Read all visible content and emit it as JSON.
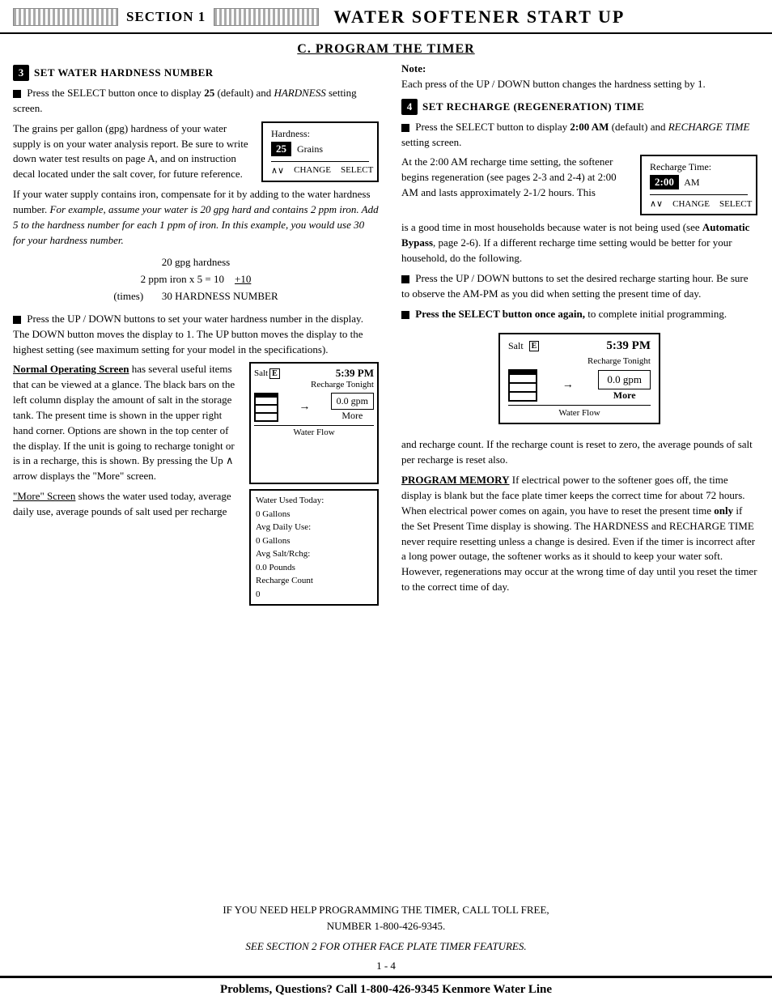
{
  "header": {
    "section_label": "SECTION 1",
    "title": "WATER SOFTENER START UP"
  },
  "subtitle": "C.  PROGRAM THE TIMER",
  "section3": {
    "num": "3",
    "title": "SET WATER HARDNESS NUMBER",
    "para1": "Press the SELECT button once to display 25 (default) and HARDNESS setting screen.",
    "para1_plain": "Press the SELECT button once to display ",
    "para1_val": "25",
    "para1_end": " (default) and ",
    "para1_italic": "HARDNESS",
    "para1_final": " setting screen.",
    "hardness_text": "The grains per gallon (gpg) hardness of your water supply is on your water analysis report. Be sure to write down water test results on page A, and on instruction decal located under the salt cover, for future reference.",
    "hardness_box_title": "Hardness:",
    "hardness_value": "25",
    "hardness_unit": "Grains",
    "btn_change": "CHANGE",
    "btn_select": "SELECT",
    "btn_av": "∧∨",
    "iron_para": "If your water supply contains iron, compensate for it by adding to the water hardness number.",
    "iron_italic": "For example, assume your water is 20 gpg hard and contains 2 ppm iron. Add 5 to the hardness number for each 1 ppm of iron. In this example, you would use 30 for your hardness number.",
    "math_gpg": "20 gpg hardness",
    "math_iron": "2 ppm iron x 5 = 10",
    "math_plus10": "+10",
    "math_times": "(times)",
    "math_result": "30 HARDNESS NUMBER",
    "set_para": "Press the UP / DOWN buttons to set your water hardness number in the display. The DOWN button moves the display to 1. The UP button moves the display to the highest setting (see maximum setting for your model in the specifications).",
    "nos_heading": "Normal Operating Screen",
    "nos_text1": "has several useful items that can be viewed at a glance. The black bars on the left column display the amount of salt in the storage tank. The present time is shown in the upper right hand corner. Options are shown in the top center of the display. If the unit is going to recharge tonight or is in a recharge, this is shown. By pressing the Up ∧ arrow displays the \"More\" screen.",
    "nos_salt": "Salt",
    "nos_e": "E",
    "nos_time": "5:39 PM",
    "nos_recharge": "Recharge Tonight",
    "nos_gpm": "0.0 gpm",
    "nos_arrow": "→",
    "nos_more": "More",
    "nos_waterflow": "Water Flow",
    "more_heading": "\"More\" Screen",
    "more_text": "shows the water used today, average daily use, average pounds of salt used per recharge",
    "more_screen_line1": "Water Used Today:",
    "more_screen_line2": "0 Gallons",
    "more_screen_line3": "Avg Daily Use:",
    "more_screen_line4": "0 Gallons",
    "more_screen_line5": "Avg Salt/Rchg:",
    "more_screen_line6": "0.0 Pounds",
    "more_screen_line7": "Recharge Count",
    "more_screen_line8": "0"
  },
  "section4": {
    "num": "4",
    "title": "SET RECHARGE (REGENERATION) TIME",
    "note_label": "Note:",
    "note_text": "Each press of the UP / DOWN button changes the hardness setting by 1.",
    "para1_plain": "Press the SELECT button to display ",
    "para1_val": "2:00 AM",
    "para1_italic": "RECHARGE TIME",
    "para1_end": " (default) and ",
    "para1_final": " setting screen.",
    "recharge_box_title": "Recharge Time:",
    "recharge_value": "2:00",
    "recharge_unit": "AM",
    "btn_av": "∧∨",
    "btn_change": "CHANGE",
    "btn_select": "SELECT",
    "recharge_desc": "At the 2:00 AM recharge time setting, the softener begins regeneration (see pages 2-3 and 2-4) at 2:00 AM and lasts approximately 2-1/2 hours. This is a good time in most households because water is not being used (see Automatic Bypass, page 2-6). If a different recharge time setting would be better for your household, do the following.",
    "set_recharge": "Press the UP / DOWN buttons to set the desired recharge starting hour. Be sure to observe the AM-PM as you did when setting the present time of day.",
    "press_select": "Press the SELECT button once again,",
    "press_select_end": " to complete initial programming.",
    "big_salt": "Salt",
    "big_e": "E",
    "big_time": "5:39 PM",
    "big_recharge": "Recharge Tonight",
    "big_gpm": "0.0 gpm",
    "big_arrow": "→",
    "big_more": "More",
    "big_waterflow": "Water Flow",
    "recharge_count_text": "and recharge count.  If the recharge count is reset to zero, the average pounds of salt per recharge is reset also.",
    "program_mem_heading": "PROGRAM MEMORY",
    "program_mem_text": " If electrical power to the softener goes off, the time display is blank but the face plate timer keeps the correct time for about 72 hours. When electrical power comes on again, you have to reset the present time ",
    "program_mem_bold": "only",
    "program_mem_text2": " if the Set Present Time display is showing.  The HARDNESS and RECHARGE TIME never require resetting unless a change is desired.  Even if the timer is incorrect after a long power outage, the softener works as it should to keep your water soft.  However, regenerations may occur at the wrong time of day until you reset the timer to the correct time of day."
  },
  "footer": {
    "help_line1": "IF YOU NEED HELP PROGRAMMING THE TIMER, CALL TOLL FREE,",
    "help_line2": "NUMBER 1-800-426-9345.",
    "see_section": "SEE SECTION 2 FOR OTHER FACE PLATE TIMER FEATURES.",
    "page_num": "1 - 4",
    "bottom_bar": "Problems, Questions? Call 1-800-426-9345 Kenmore Water Line"
  }
}
